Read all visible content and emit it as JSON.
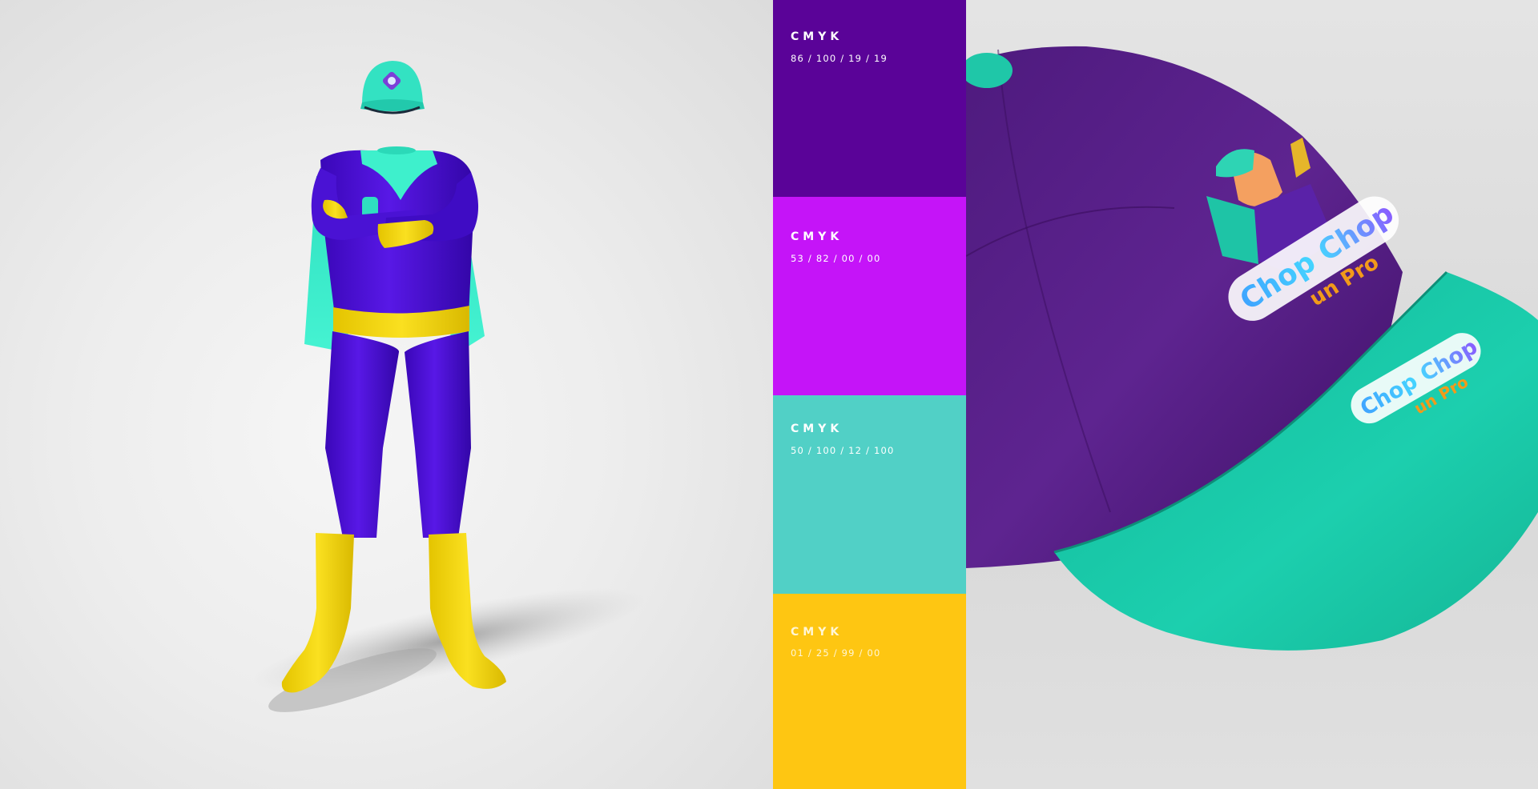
{
  "swatches": [
    {
      "title": "CMYK",
      "value": "86 / 100 / 19 / 19",
      "color": "#5a0398"
    },
    {
      "title": "CMYK",
      "value": "53 / 82 / 00 / 00",
      "color": "#c514f8"
    },
    {
      "title": "CMYK",
      "value": "50 / 100 / 12 / 100",
      "color": "#51d0c6"
    },
    {
      "title": "CMYK",
      "value": "01 / 25 / 99 / 00",
      "color": "#fec612"
    }
  ],
  "suit": {
    "body_color": "#4a0fd8",
    "accent_color": "#3ef0cc",
    "gold_color": "#f2d60a"
  },
  "cap": {
    "crown_color": "#5b1a86",
    "brim_color": "#19c8a8",
    "logo_line1": "Chop Chop",
    "logo_line2": "un Pro"
  }
}
